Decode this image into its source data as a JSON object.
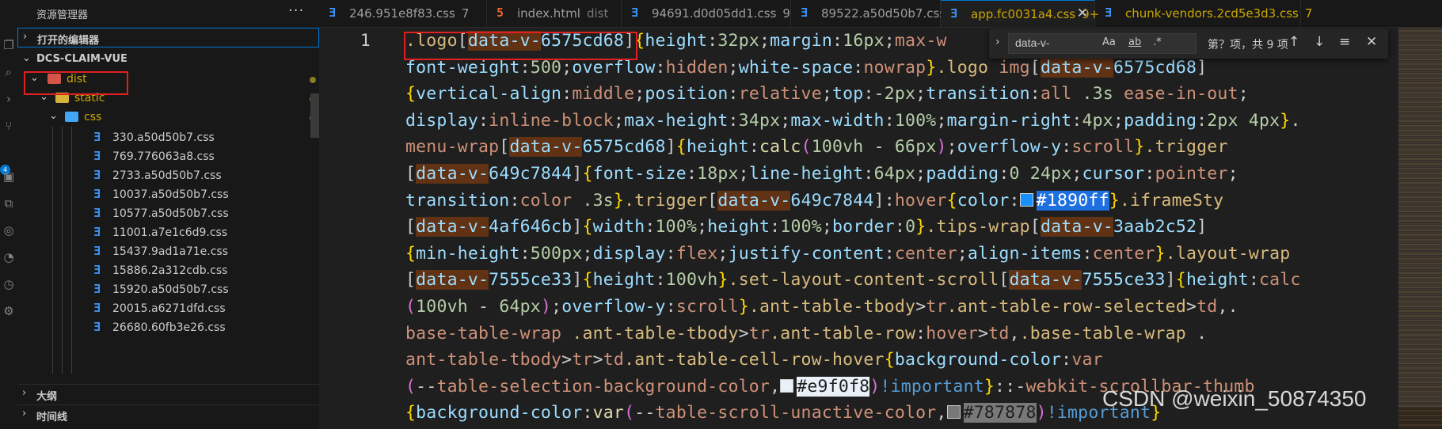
{
  "sidebar": {
    "title": "资源管理器",
    "more": "···",
    "open_editors": "打开的编辑器",
    "project": "DCS-CLAIM-VUE",
    "dist": "dist",
    "static": "static",
    "css": "css",
    "files": [
      "330.a50d50b7.css",
      "769.776063a8.css",
      "2733.a50d50b7.css",
      "10037.a50d50b7.css",
      "10577.a50d50b7.css",
      "11001.a7e1c6d9.css",
      "15437.9ad1a71e.css",
      "15886.2a312cdb.css",
      "15920.a50d50b7.css",
      "20015.a6271dfd.css",
      "26680.60fb3e26.css"
    ],
    "outline": "大纲",
    "timeline": "时间线"
  },
  "tabs": [
    {
      "name": "246.951e8f83.css",
      "count": "7"
    },
    {
      "name": "index.html",
      "count": "dist"
    },
    {
      "name": "94691.d0d05dd1.css",
      "count": "9"
    },
    {
      "name": "89522.a50d50b7.css",
      "count": ""
    },
    {
      "name": "app.fc0031a4.css",
      "count": "9+"
    },
    {
      "name": "chunk-vendors.2cd5e3d3.css",
      "count": "7"
    }
  ],
  "editor": {
    "line_number": "1",
    "code": [
      ".logo[data-v-6575cd68]{height:32px;margin:16px;max-w",
      "font-weight:500;overflow:hidden;white-space:nowrap}.logo img[data-v-6575cd68]",
      "{vertical-align:middle;position:relative;top:-2px;transition:all .3s ease-in-out;",
      "display:inline-block;max-height:34px;max-width:100%;margin-right:4px;padding:2px 4px}.",
      "menu-wrap[data-v-6575cd68]{height:calc(100vh - 66px);overflow-y:scroll}.trigger",
      "[data-v-649c7844]{font-size:18px;line-height:64px;padding:0 24px;cursor:pointer;",
      "transition:color .3s}.trigger[data-v-649c7844]:hover{color:#1890ff}.iframeSty",
      "[data-v-4af646cb]{width:100%;height:100%;border:0}.tips-wrap[data-v-3aab2c52]",
      "{min-height:500px;display:flex;justify-content:center;align-items:center}.layout-wrap",
      "[data-v-7555ce33]{height:100vh}.set-layout-content-scroll[data-v-7555ce33]{height:calc",
      "(100vh - 64px);overflow-y:scroll}.ant-table-tbody>tr.ant-table-row-selected>td,.",
      "base-table-wrap .ant-table-tbody>tr.ant-table-row:hover>td,.base-table-wrap .",
      "ant-table-tbody>tr>td.ant-table-cell-row-hover{background-color:var",
      "(--table-selection-background-color,#e9f0f8)!important}::-webkit-scrollbar-thumb",
      "{background-color:var(--table-scroll-unactive-color,#787878)!important}"
    ],
    "colors": {
      "c1": "#1890ff",
      "c2": "#e9f0f8",
      "c3": "#787878"
    }
  },
  "find": {
    "query": "data-v-",
    "opt_case": "Aa",
    "opt_word": "ab",
    "opt_regex": ".*",
    "result": "第？项，共 9 项"
  },
  "watermark": "CSDN @weixin_50874350"
}
